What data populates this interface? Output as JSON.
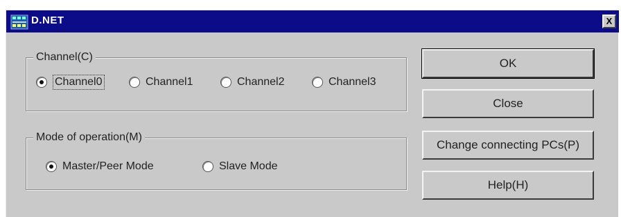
{
  "window": {
    "title": "D.NET",
    "close_label": "X"
  },
  "channel_group": {
    "label": "Channel(C)",
    "options": [
      {
        "label": "Channel0",
        "checked": true
      },
      {
        "label": "Channel1",
        "checked": false
      },
      {
        "label": "Channel2",
        "checked": false
      },
      {
        "label": "Channel3",
        "checked": false
      }
    ]
  },
  "mode_group": {
    "label": "Mode of operation(M)",
    "options": [
      {
        "label": "Master/Peer Mode",
        "checked": true
      },
      {
        "label": "Slave Mode",
        "checked": false
      }
    ]
  },
  "buttons": {
    "ok": "OK",
    "close": "Close",
    "change_pcs": "Change connecting PCs(P)",
    "help": "Help(H)"
  },
  "colors": {
    "titlebar": "#0c0c88",
    "dialog_bg": "#c9c9c9"
  },
  "icons": {
    "app": "network-icon",
    "close": "close-icon",
    "radio": "radio-icon"
  }
}
